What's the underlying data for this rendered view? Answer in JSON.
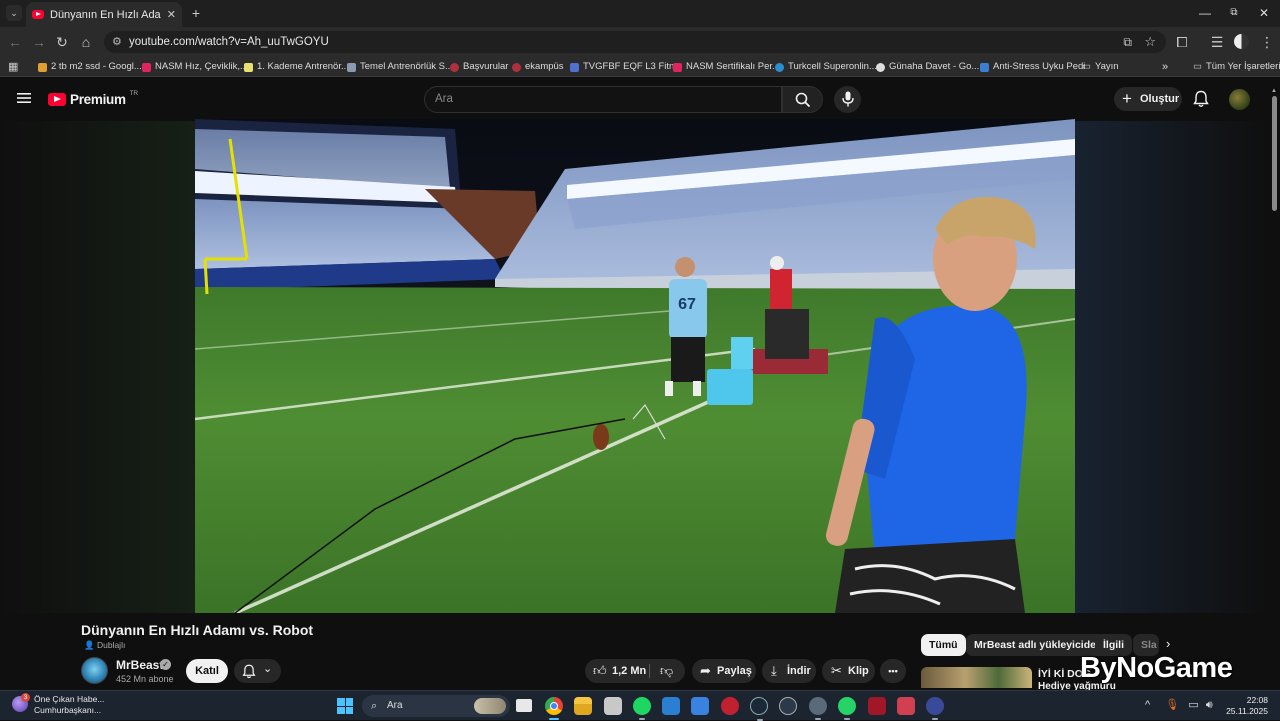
{
  "browser": {
    "tab_title": "Dünyanın En Hızlı Adamı vs. Ro",
    "url": "youtube.com/watch?v=Ah_uuTwGOYU",
    "bookmarks": [
      {
        "label": "2 tb m2 ssd - Googl...",
        "color": "#e0a030"
      },
      {
        "label": "NASM Hız, Çeviklik,...",
        "color": "#e0245e"
      },
      {
        "label": "1. Kademe Antrenör...",
        "color": "#e8e070"
      },
      {
        "label": "Temel Antrenörlük S...",
        "color": "#8a9ab0"
      },
      {
        "label": "Başvurular",
        "color": "#b03040"
      },
      {
        "label": "ekampüs",
        "color": "#b03040"
      },
      {
        "label": "TVGFBF EQF L3 Fitn...",
        "color": "#5070d0"
      },
      {
        "label": "NASM Sertifikalı Per...",
        "color": "#e0245e"
      },
      {
        "label": "Turkcell Superonlin...",
        "color": "#2a8fd0"
      },
      {
        "label": "Günaha Davet - Go...",
        "color": "#dddddd"
      },
      {
        "label": "Anti-Stress Uyku Pedi",
        "color": "#3a7fd0"
      },
      {
        "label": "Yayın",
        "color": "#999999"
      }
    ],
    "bookmarks_overflow": "»",
    "all_bookmarks": "Tüm Yer İşaretleri"
  },
  "youtube": {
    "logo_text": "Premium",
    "logo_region": "TR",
    "search_placeholder": "Ara",
    "create_label": "Oluştur",
    "video": {
      "title": "Dünyanın En Hızlı Adamı vs. Robot",
      "dub_badge": "Dublajlı",
      "channel": "MrBeast",
      "subscribers": "452 Mn abone",
      "join_label": "Katıl",
      "likes": "1,2 Mn",
      "share_label": "Paylaş",
      "download_label": "İndir",
      "clip_label": "Klip",
      "more_label": "•••",
      "jersey_number": "67"
    },
    "chips": [
      "Tümü",
      "MrBeast adlı yükleyiciden",
      "İlgili",
      "Sla"
    ],
    "recommendation": {
      "title": "İYİ Kİ DOĞ",
      "subtitle": "Hediye yağmuru"
    },
    "watermark": "ByNoGame"
  },
  "taskbar": {
    "news_count": "3",
    "news_title": "Öne Çıkan Habe...",
    "news_sub": "Cumhurbaşkanı...",
    "search_placeholder": "Ara",
    "time": "22:08",
    "date": "25.11.2025"
  },
  "colors": {
    "yt_red": "#ff0033",
    "background": "#0f0f0f",
    "chip_bg": "#272727"
  }
}
